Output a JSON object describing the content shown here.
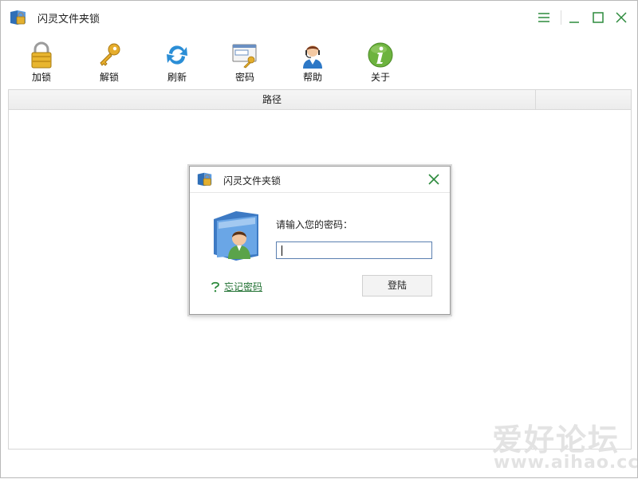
{
  "window": {
    "title": "闪灵文件夹锁",
    "controls": {
      "menu_icon": "menu-icon",
      "minimize_icon": "minimize-icon",
      "maximize_icon": "maximize-icon",
      "close_icon": "close-icon"
    }
  },
  "toolbar": {
    "items": [
      {
        "label": "加锁",
        "icon": "padlock-icon"
      },
      {
        "label": "解锁",
        "icon": "key-icon"
      },
      {
        "label": "刷新",
        "icon": "refresh-icon"
      },
      {
        "label": "密码",
        "icon": "password-icon"
      },
      {
        "label": "帮助",
        "icon": "support-agent-icon"
      },
      {
        "label": "关于",
        "icon": "info-icon"
      }
    ]
  },
  "list": {
    "columns": [
      "路径",
      ""
    ]
  },
  "dialog": {
    "title": "闪灵文件夹锁",
    "prompt": "请输入您的密码：",
    "password_value": "",
    "forgot_link": "忘记密码",
    "login_button": "登陆"
  },
  "watermark": {
    "main": "爱好论坛",
    "sub": "www.aihao.cc"
  },
  "colors": {
    "accent_green": "#1d6f2f",
    "close_green": "#2c8a3c",
    "input_border": "#5a7fb0"
  }
}
